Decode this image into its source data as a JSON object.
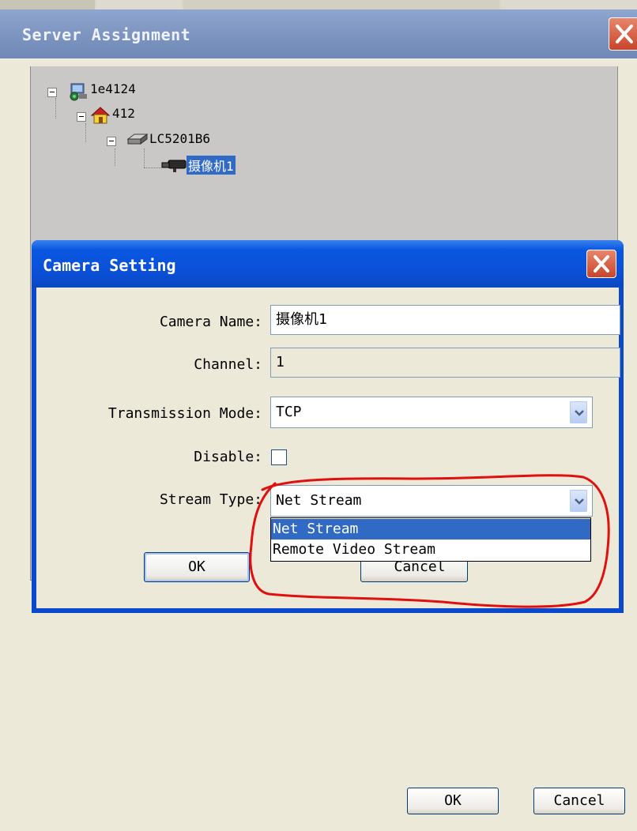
{
  "outer_window": {
    "title": "Server Assignment",
    "ok_label": "OK",
    "cancel_label": "Cancel"
  },
  "tree": {
    "nodes": [
      {
        "label": "1e4124",
        "icon": "network-server-icon"
      },
      {
        "label": "412",
        "icon": "house-icon"
      },
      {
        "label": "LC5201B6",
        "icon": "dvr-device-icon"
      },
      {
        "label": "摄像机1",
        "icon": "camera-icon",
        "selected": true
      }
    ]
  },
  "dialog": {
    "title": "Camera Setting",
    "camera_name_label": "Camera Name:",
    "camera_name_value": "摄像机1",
    "channel_label": "Channel:",
    "channel_value": "1",
    "transmission_label": "Transmission Mode:",
    "transmission_value": "TCP",
    "disable_label": "Disable:",
    "disable_checked": false,
    "stream_type_label": "Stream Type:",
    "stream_type_value": "Net Stream",
    "stream_type_options": [
      "Net Stream",
      "Remote Video Stream"
    ],
    "ok_label": "OK",
    "cancel_label": "Cancel"
  },
  "colors": {
    "dialog_title": "#0a4fd6",
    "selection": "#316ac5",
    "annotation": "#e01010",
    "outer_title": "#7d95c0"
  }
}
